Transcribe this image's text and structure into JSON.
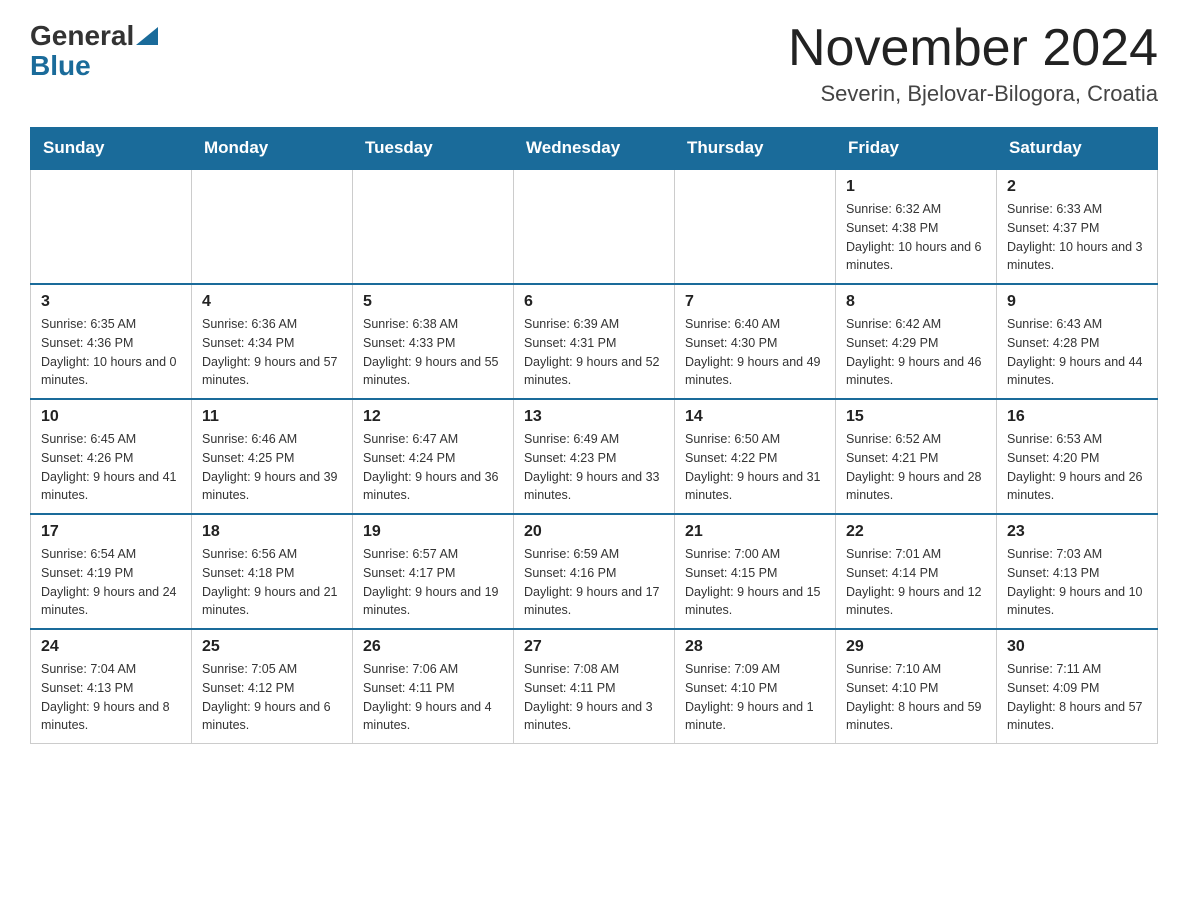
{
  "logo": {
    "general": "General",
    "blue": "Blue"
  },
  "header": {
    "month_year": "November 2024",
    "location": "Severin, Bjelovar-Bilogora, Croatia"
  },
  "weekdays": [
    "Sunday",
    "Monday",
    "Tuesday",
    "Wednesday",
    "Thursday",
    "Friday",
    "Saturday"
  ],
  "weeks": [
    [
      {
        "day": "",
        "info": ""
      },
      {
        "day": "",
        "info": ""
      },
      {
        "day": "",
        "info": ""
      },
      {
        "day": "",
        "info": ""
      },
      {
        "day": "",
        "info": ""
      },
      {
        "day": "1",
        "info": "Sunrise: 6:32 AM\nSunset: 4:38 PM\nDaylight: 10 hours and 6 minutes."
      },
      {
        "day": "2",
        "info": "Sunrise: 6:33 AM\nSunset: 4:37 PM\nDaylight: 10 hours and 3 minutes."
      }
    ],
    [
      {
        "day": "3",
        "info": "Sunrise: 6:35 AM\nSunset: 4:36 PM\nDaylight: 10 hours and 0 minutes."
      },
      {
        "day": "4",
        "info": "Sunrise: 6:36 AM\nSunset: 4:34 PM\nDaylight: 9 hours and 57 minutes."
      },
      {
        "day": "5",
        "info": "Sunrise: 6:38 AM\nSunset: 4:33 PM\nDaylight: 9 hours and 55 minutes."
      },
      {
        "day": "6",
        "info": "Sunrise: 6:39 AM\nSunset: 4:31 PM\nDaylight: 9 hours and 52 minutes."
      },
      {
        "day": "7",
        "info": "Sunrise: 6:40 AM\nSunset: 4:30 PM\nDaylight: 9 hours and 49 minutes."
      },
      {
        "day": "8",
        "info": "Sunrise: 6:42 AM\nSunset: 4:29 PM\nDaylight: 9 hours and 46 minutes."
      },
      {
        "day": "9",
        "info": "Sunrise: 6:43 AM\nSunset: 4:28 PM\nDaylight: 9 hours and 44 minutes."
      }
    ],
    [
      {
        "day": "10",
        "info": "Sunrise: 6:45 AM\nSunset: 4:26 PM\nDaylight: 9 hours and 41 minutes."
      },
      {
        "day": "11",
        "info": "Sunrise: 6:46 AM\nSunset: 4:25 PM\nDaylight: 9 hours and 39 minutes."
      },
      {
        "day": "12",
        "info": "Sunrise: 6:47 AM\nSunset: 4:24 PM\nDaylight: 9 hours and 36 minutes."
      },
      {
        "day": "13",
        "info": "Sunrise: 6:49 AM\nSunset: 4:23 PM\nDaylight: 9 hours and 33 minutes."
      },
      {
        "day": "14",
        "info": "Sunrise: 6:50 AM\nSunset: 4:22 PM\nDaylight: 9 hours and 31 minutes."
      },
      {
        "day": "15",
        "info": "Sunrise: 6:52 AM\nSunset: 4:21 PM\nDaylight: 9 hours and 28 minutes."
      },
      {
        "day": "16",
        "info": "Sunrise: 6:53 AM\nSunset: 4:20 PM\nDaylight: 9 hours and 26 minutes."
      }
    ],
    [
      {
        "day": "17",
        "info": "Sunrise: 6:54 AM\nSunset: 4:19 PM\nDaylight: 9 hours and 24 minutes."
      },
      {
        "day": "18",
        "info": "Sunrise: 6:56 AM\nSunset: 4:18 PM\nDaylight: 9 hours and 21 minutes."
      },
      {
        "day": "19",
        "info": "Sunrise: 6:57 AM\nSunset: 4:17 PM\nDaylight: 9 hours and 19 minutes."
      },
      {
        "day": "20",
        "info": "Sunrise: 6:59 AM\nSunset: 4:16 PM\nDaylight: 9 hours and 17 minutes."
      },
      {
        "day": "21",
        "info": "Sunrise: 7:00 AM\nSunset: 4:15 PM\nDaylight: 9 hours and 15 minutes."
      },
      {
        "day": "22",
        "info": "Sunrise: 7:01 AM\nSunset: 4:14 PM\nDaylight: 9 hours and 12 minutes."
      },
      {
        "day": "23",
        "info": "Sunrise: 7:03 AM\nSunset: 4:13 PM\nDaylight: 9 hours and 10 minutes."
      }
    ],
    [
      {
        "day": "24",
        "info": "Sunrise: 7:04 AM\nSunset: 4:13 PM\nDaylight: 9 hours and 8 minutes."
      },
      {
        "day": "25",
        "info": "Sunrise: 7:05 AM\nSunset: 4:12 PM\nDaylight: 9 hours and 6 minutes."
      },
      {
        "day": "26",
        "info": "Sunrise: 7:06 AM\nSunset: 4:11 PM\nDaylight: 9 hours and 4 minutes."
      },
      {
        "day": "27",
        "info": "Sunrise: 7:08 AM\nSunset: 4:11 PM\nDaylight: 9 hours and 3 minutes."
      },
      {
        "day": "28",
        "info": "Sunrise: 7:09 AM\nSunset: 4:10 PM\nDaylight: 9 hours and 1 minute."
      },
      {
        "day": "29",
        "info": "Sunrise: 7:10 AM\nSunset: 4:10 PM\nDaylight: 8 hours and 59 minutes."
      },
      {
        "day": "30",
        "info": "Sunrise: 7:11 AM\nSunset: 4:09 PM\nDaylight: 8 hours and 57 minutes."
      }
    ]
  ]
}
